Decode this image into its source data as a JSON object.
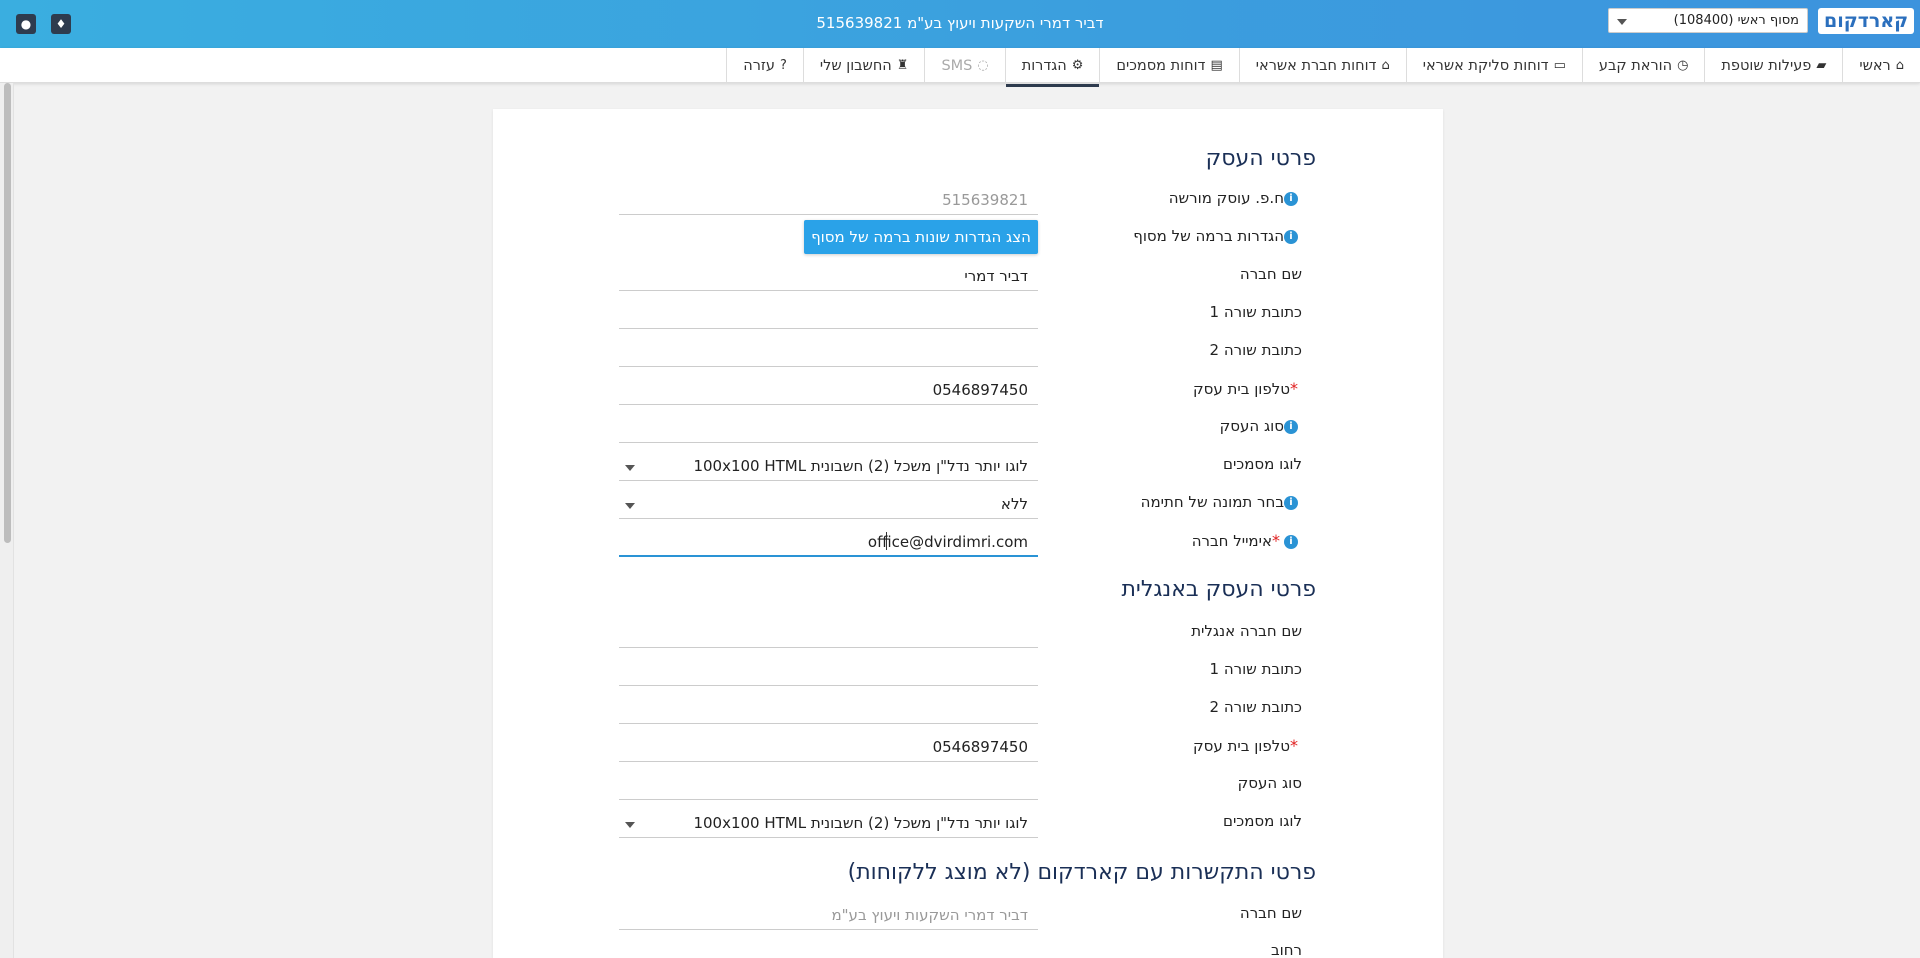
{
  "header": {
    "title": "דביר דמרי השקעות ויעוץ בע\"מ 515639821",
    "terminal_select": "מסוף ראשי (108400)",
    "logo": "קארדקום"
  },
  "nav": {
    "items": [
      {
        "label": "ראשי",
        "icon": "home-icon",
        "glyph": "⌂"
      },
      {
        "label": "פעילות שוטפת",
        "icon": "briefcase-icon",
        "glyph": "▰"
      },
      {
        "label": "הוראת קבע",
        "icon": "clock-icon",
        "glyph": "◷"
      },
      {
        "label": "דוחות סליקת אשראי",
        "icon": "credit-card-icon",
        "glyph": "▭"
      },
      {
        "label": "דוחות חברת אשראי",
        "icon": "bank-icon",
        "glyph": "⌂"
      },
      {
        "label": "דוחות מסמכים",
        "icon": "document-icon",
        "glyph": "▤"
      },
      {
        "label": "הגדרות",
        "icon": "gears-icon",
        "glyph": "⚙"
      },
      {
        "label": "SMS",
        "icon": "comment-icon",
        "glyph": "◌"
      },
      {
        "label": "החשבון שלי",
        "icon": "user-tie-icon",
        "glyph": "♜"
      },
      {
        "label": "עזרה",
        "icon": "question-icon",
        "glyph": "?"
      }
    ]
  },
  "business": {
    "title": "פרטי העסק",
    "fields": {
      "dealer_id": {
        "label": "ח.פ. עוסק מורשה",
        "value": "515639821"
      },
      "terminal_settings": {
        "label": "הגדרות ברמה של מסוף",
        "button": "הצג הגדרות שונות ברמה של מסוף"
      },
      "company_name": {
        "label": "שם חברה",
        "value": "דביר דמרי"
      },
      "address1": {
        "label": "כתובת שורה 1",
        "value": ""
      },
      "address2": {
        "label": "כתובת שורה 2",
        "value": ""
      },
      "phone": {
        "label": "טלפון בית עסק",
        "value": "0546897450"
      },
      "business_type": {
        "label": "סוג העסק",
        "value": ""
      },
      "docs_logo": {
        "label": "לוגו מסמכים",
        "value": "לוגו יותר נדל\"ן משכל (2) חשבונית 100x100   HTML"
      },
      "signature": {
        "label": "בחר תמונה של חתימה",
        "value": "ללא"
      },
      "email": {
        "label": "אימייל חברה",
        "value": "office@dvirdimri.com"
      }
    }
  },
  "business_en": {
    "title": "פרטי העסק באנגלית",
    "fields": {
      "company_name": {
        "label": "שם חברה אנגלית",
        "value": ""
      },
      "address1": {
        "label": "כתובת שורה 1",
        "value": ""
      },
      "address2": {
        "label": "כתובת שורה 2",
        "value": ""
      },
      "phone": {
        "label": "טלפון בית עסק",
        "value": "0546897450"
      },
      "business_type": {
        "label": "סוג העסק",
        "value": ""
      },
      "docs_logo": {
        "label": "לוגו מסמכים",
        "value": "לוגו יותר נדל\"ן משכל (2) חשבונית 100x100   HTML"
      }
    }
  },
  "contact": {
    "title": "פרטי התקשרות עם קארדקום (לא מוצג ללקוחות)",
    "fields": {
      "company_name": {
        "label": "שם חברה",
        "value": "דביר דמרי השקעות ויעוץ בע\"מ"
      },
      "street": {
        "label": "רחוב",
        "value": ""
      }
    }
  }
}
